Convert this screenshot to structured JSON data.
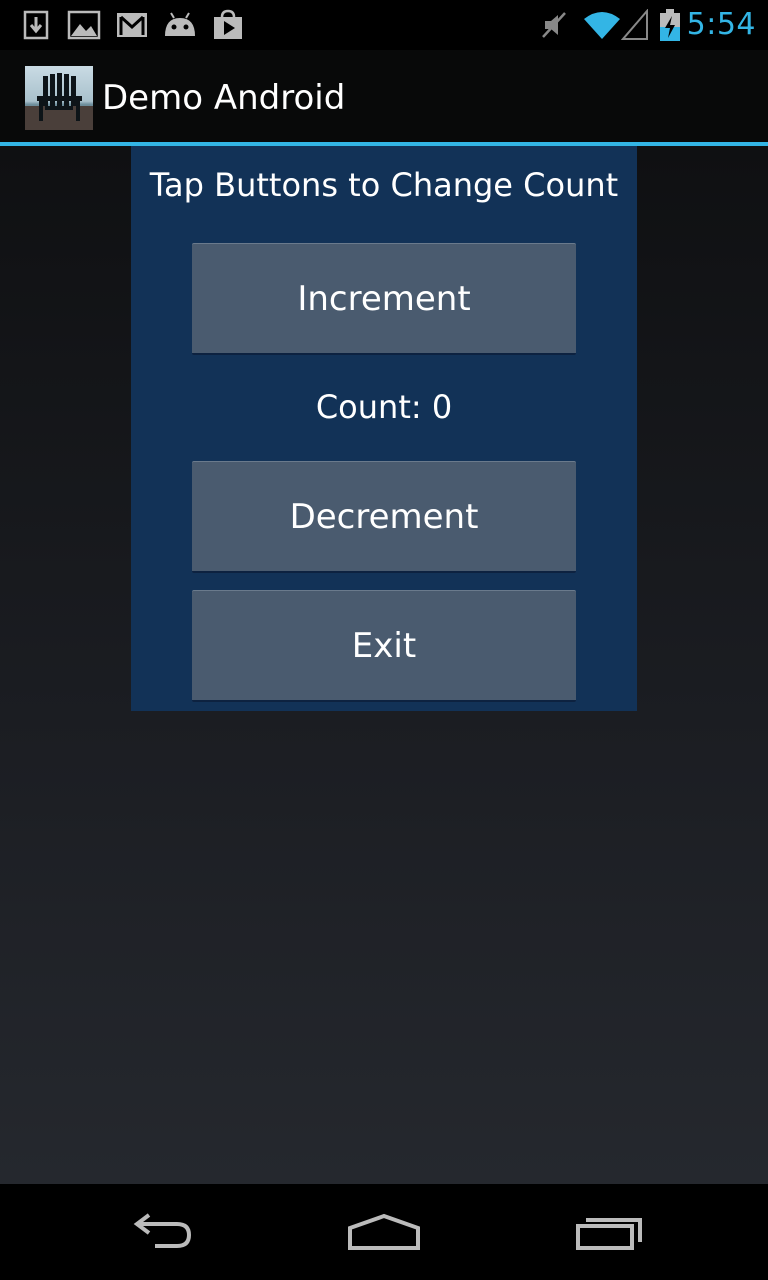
{
  "status_bar": {
    "time": "5:54",
    "icons": [
      "download-icon",
      "image-icon",
      "gmail-icon",
      "android-icon",
      "play-store-icon",
      "mute-icon",
      "wifi-icon",
      "signal-icon",
      "battery-charging-icon"
    ],
    "accent_color": "#33b5e5"
  },
  "action_bar": {
    "title": "Demo Android",
    "icon": "adirondack-chair-photo"
  },
  "main": {
    "heading": "Tap Buttons to Change Count",
    "increment_label": "Increment",
    "count_text": "Count: 0",
    "decrement_label": "Decrement",
    "exit_label": "Exit",
    "panel_color": "#123257",
    "button_color": "#4a5b6f"
  },
  "nav_bar": {
    "icons": [
      "back-icon",
      "home-icon",
      "recents-icon"
    ]
  }
}
